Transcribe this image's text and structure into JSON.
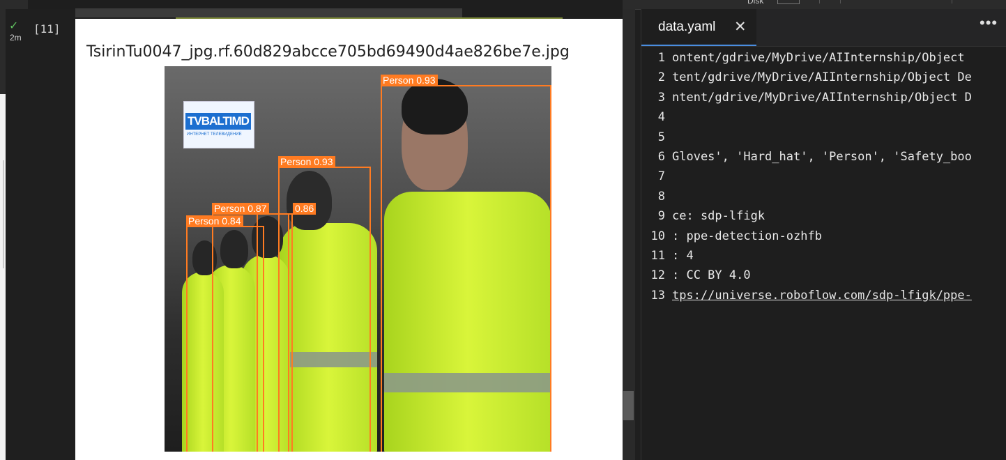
{
  "top_bar": {
    "disk_label": "Disk"
  },
  "cell": {
    "status_icon": "check-icon",
    "elapsed": "2m",
    "execution_count": "[11]",
    "output": {
      "title": "TsirinTu0047_jpg.rf.60d829abcce705bd69490d4ae826be7e.jpg",
      "logo_text": "TVBALTIMD",
      "logo_subtext": "ИНТЕРНЕТ ТЕЛЕВИДЕНИЕ",
      "box_color": "#ff7b21",
      "detections": [
        {
          "label": "Person 0.93"
        },
        {
          "label": "Person 0.93"
        },
        {
          "label": "Person 0.87"
        },
        {
          "label": "0.86"
        },
        {
          "label": "Person 0.84"
        }
      ]
    }
  },
  "editor": {
    "tab": {
      "label": "data.yaml",
      "close_icon": "close-icon"
    },
    "more_icon": "more-actions-icon",
    "lines": [
      {
        "n": "1",
        "text": "ontent/gdrive/MyDrive/AIInternship/Object"
      },
      {
        "n": "2",
        "text": "tent/gdrive/MyDrive/AIInternship/Object De"
      },
      {
        "n": "3",
        "text": "ntent/gdrive/MyDrive/AIInternship/Object D"
      },
      {
        "n": "4",
        "text": ""
      },
      {
        "n": "5",
        "text": ""
      },
      {
        "n": "6",
        "text": "Gloves', 'Hard_hat', 'Person', 'Safety_boo"
      },
      {
        "n": "7",
        "text": ""
      },
      {
        "n": "8",
        "text": ""
      },
      {
        "n": "9",
        "text": "ce: sdp-lfigk"
      },
      {
        "n": "10",
        "text": ": ppe-detection-ozhfb"
      },
      {
        "n": "11",
        "text": ": 4"
      },
      {
        "n": "12",
        "text": ": CC BY 4.0"
      },
      {
        "n": "13",
        "text": "tps://universe.roboflow.com/sdp-lfigk/ppe-"
      }
    ]
  }
}
